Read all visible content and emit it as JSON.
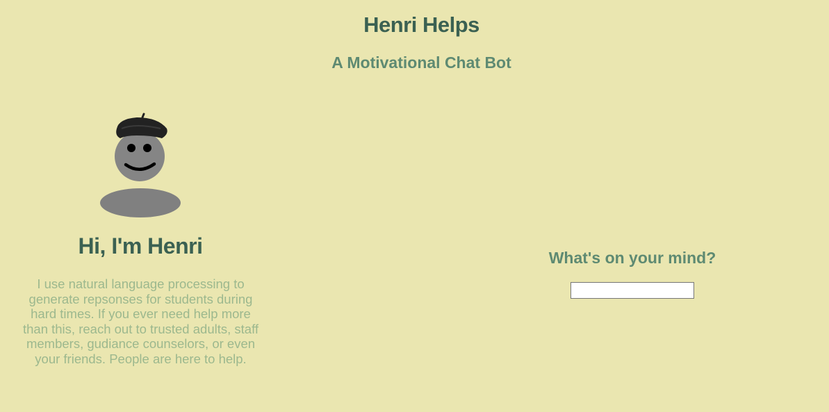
{
  "header": {
    "title": "Henri Helps",
    "subtitle": "A Motivational Chat Bot"
  },
  "bot": {
    "avatar_icon": "smiling-henri-with-beret-icon",
    "greeting": "Hi, I'm Henri",
    "description": "I use natural language processing to generate repsonses for students during hard times. If you ever need help more than this, reach out to trusted adults, staff members, gudiance counselors, or even your friends. People are here to help."
  },
  "chat": {
    "prompt": "What's on your mind?",
    "input_value": "",
    "input_placeholder": ""
  },
  "colors": {
    "background": "#eae6b0",
    "title": "#3b6152",
    "subtitle": "#5e8a72",
    "body_text": "#9cb88e",
    "avatar": "#808080"
  }
}
